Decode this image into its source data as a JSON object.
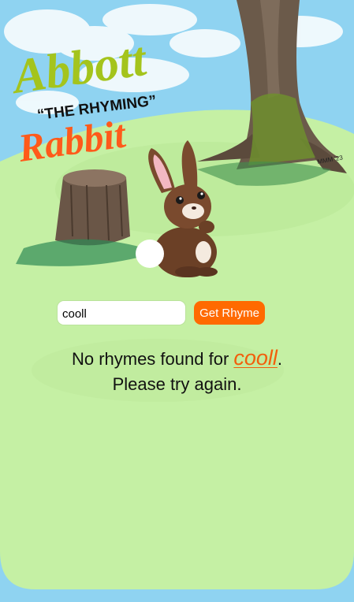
{
  "app": {
    "title_line1": "Abbott",
    "title_line2": "“THE RHYMING”",
    "title_line3": "Rabbit",
    "artist_signature": "MMM '23"
  },
  "form": {
    "input_value": "cooll",
    "button_label": "Get Rhyme"
  },
  "result": {
    "prefix": "No rhymes found for ",
    "word": "cooll",
    "suffix": ".",
    "line2": "Please try again."
  },
  "colors": {
    "sky": "#8fd3f1",
    "grass": "#c5f0a4",
    "accent": "#ff6a00",
    "title_green": "#a4c41c",
    "title_orange": "#ff5a1a"
  }
}
